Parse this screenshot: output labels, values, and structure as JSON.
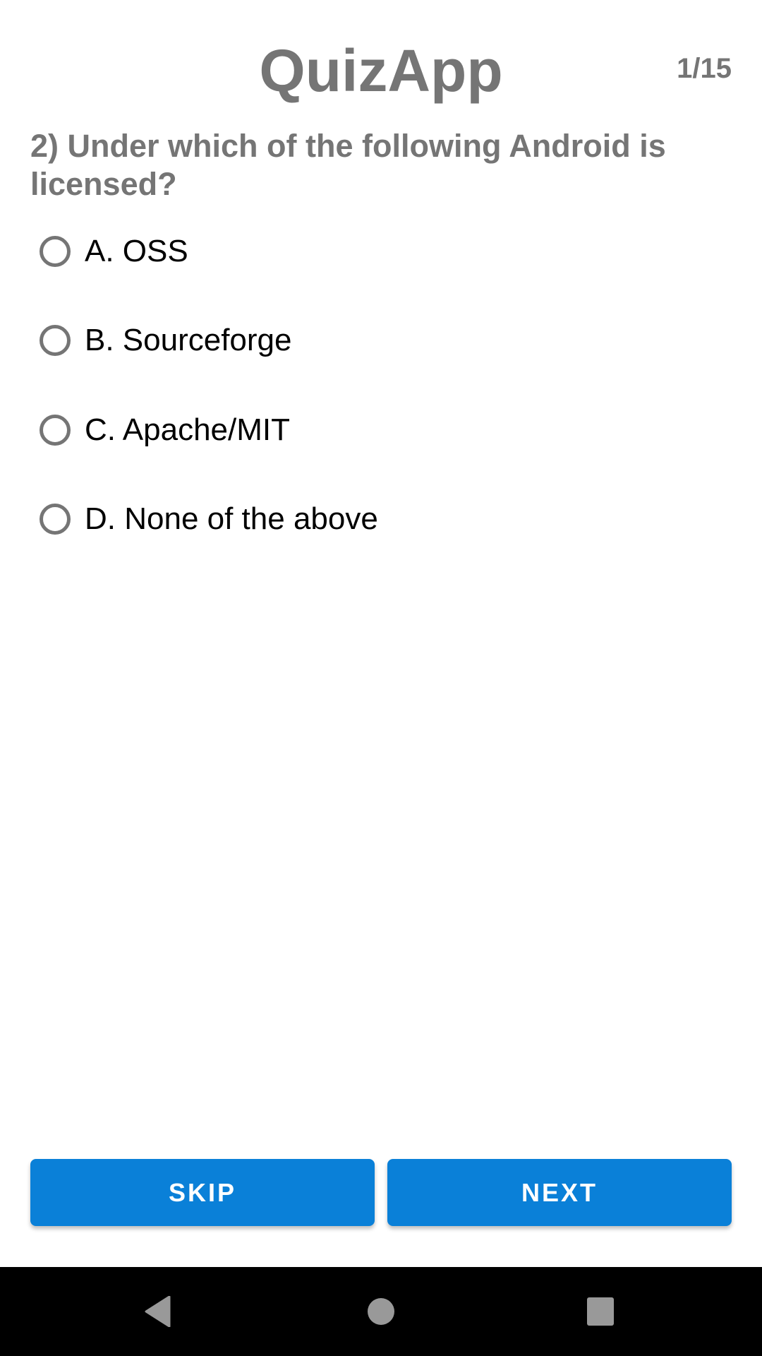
{
  "header": {
    "title": "QuizApp",
    "progress": "1/15"
  },
  "question": {
    "text": "2) Under which of the following Android is licensed?"
  },
  "options": [
    {
      "label": "A. OSS",
      "selected": false
    },
    {
      "label": "B. Sourceforge",
      "selected": false
    },
    {
      "label": "C. Apache/MIT",
      "selected": false
    },
    {
      "label": "D. None of the above",
      "selected": false
    }
  ],
  "buttons": {
    "skip": "SKIP",
    "next": "NEXT"
  },
  "colors": {
    "accent": "#0a80d8",
    "text_gray": "#757575",
    "nav_bar": "#000000",
    "nav_icons": "#999999"
  },
  "navbar": {
    "icons": [
      "back-icon",
      "home-icon",
      "recents-icon"
    ]
  }
}
